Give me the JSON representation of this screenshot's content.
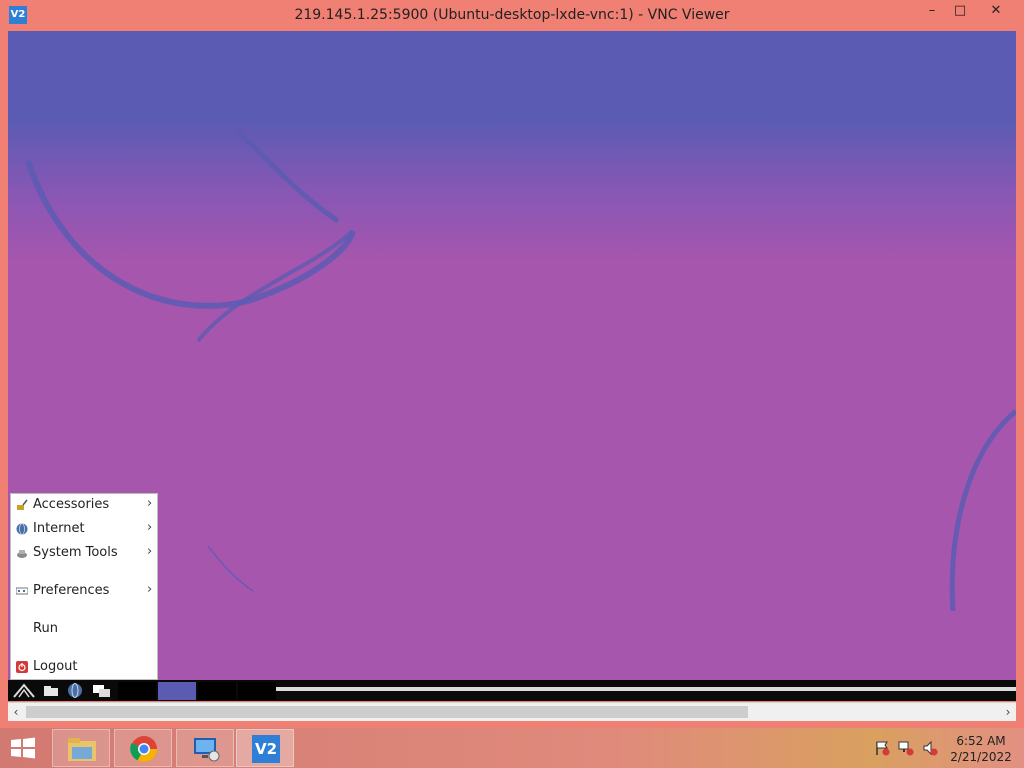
{
  "window": {
    "title": "219.145.1.25:5900 (Ubuntu-desktop-lxde-vnc:1) - VNC Viewer",
    "app_icon_text": "V2",
    "minimize": "–",
    "maximize": "□",
    "close": "✕"
  },
  "start_menu": {
    "items": [
      {
        "label": "Accessories",
        "icon": "accessories-icon",
        "submenu": true
      },
      {
        "label": "Internet",
        "icon": "globe-icon",
        "submenu": true
      },
      {
        "label": "System Tools",
        "icon": "system-tools-icon",
        "submenu": true
      },
      {
        "label": "Preferences",
        "icon": "preferences-icon",
        "submenu": true
      },
      {
        "label": "Run",
        "icon": "",
        "submenu": false
      },
      {
        "label": "Logout",
        "icon": "logout-icon",
        "submenu": false
      }
    ],
    "submenu_arrow": "›"
  },
  "scrollbar": {
    "left_arrow": "‹",
    "right_arrow": "›"
  },
  "taskbar": {
    "apps": [
      "file-explorer-icon",
      "chrome-icon",
      "remote-desktop-icon",
      "vnc-viewer-icon"
    ],
    "vnc_icon_text": "V2",
    "time": "6:52 AM",
    "date": "2/21/2022"
  },
  "colors": {
    "frame": "#f07f74",
    "desktop_purple": "#a756ad",
    "desktop_blue": "#5c5bb3",
    "vnc_blue": "#2f7fd6"
  }
}
